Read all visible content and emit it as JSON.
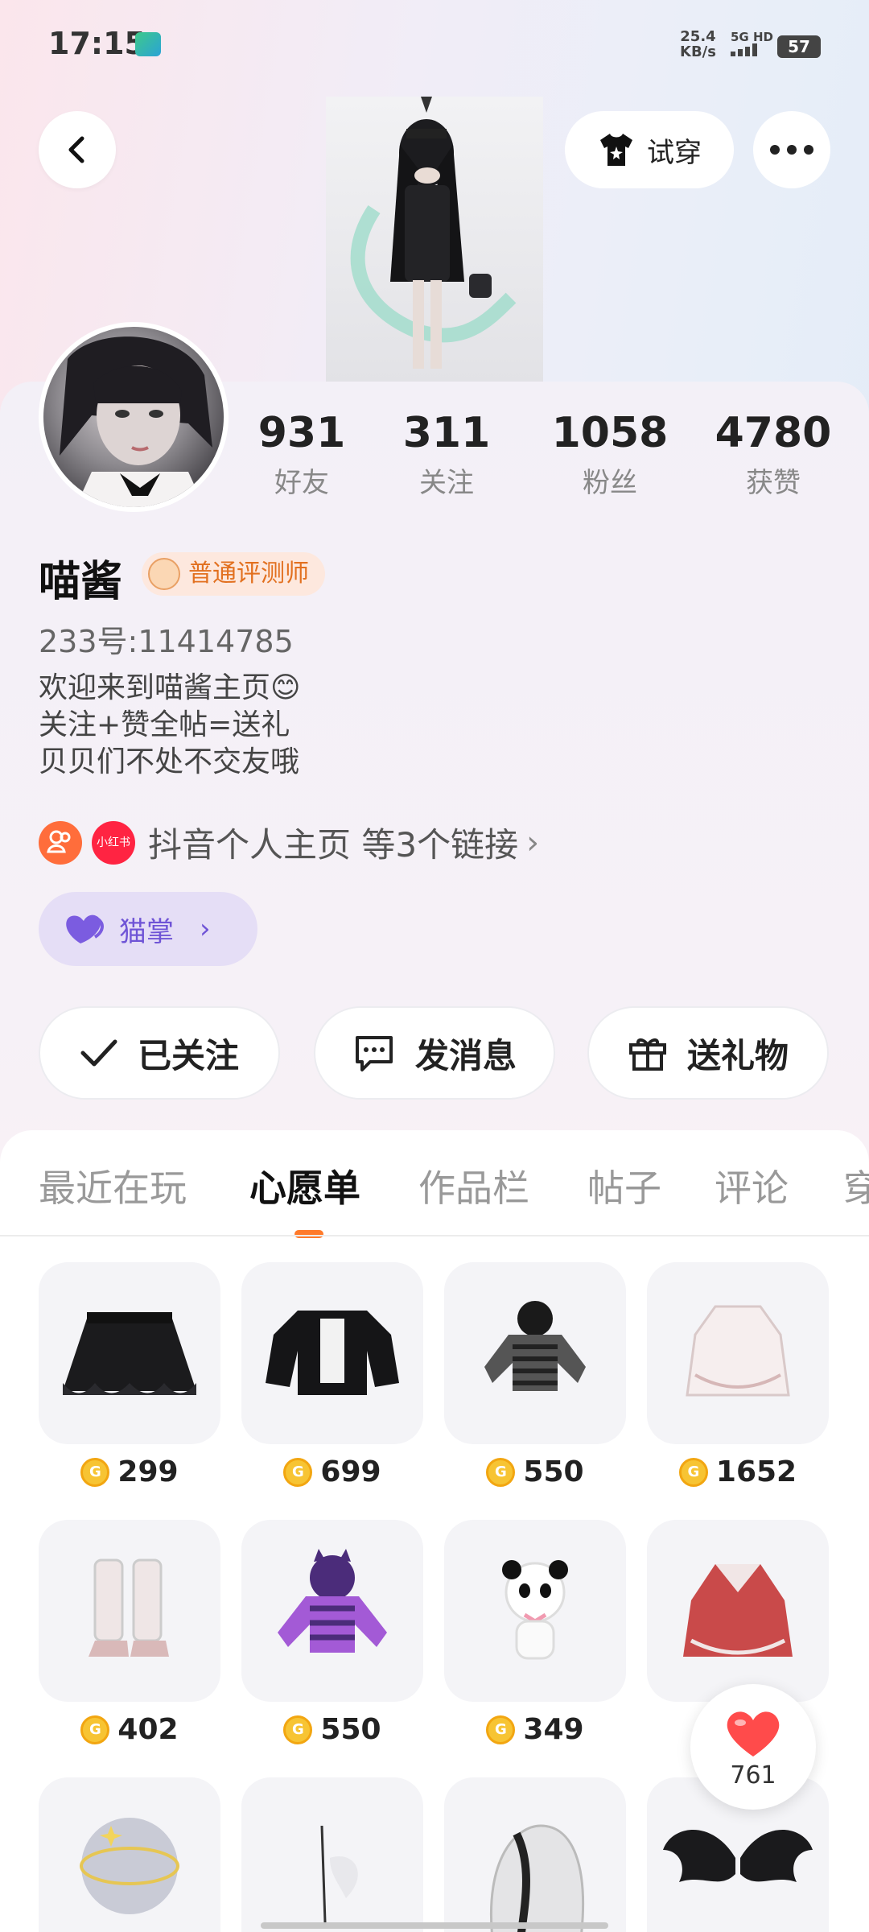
{
  "status_bar": {
    "time": "17:15",
    "net_speed_value": "25.4",
    "net_speed_unit": "KB/s",
    "network": "5G HD",
    "battery": "57"
  },
  "header": {
    "tryon_label": "试穿"
  },
  "profile": {
    "stats": [
      {
        "value": "931",
        "label": "好友"
      },
      {
        "value": "311",
        "label": "关注"
      },
      {
        "value": "1058",
        "label": "粉丝"
      },
      {
        "value": "4780",
        "label": "获赞"
      }
    ],
    "username": "喵酱",
    "badge": "普通评测师",
    "uid": "233号:11414785",
    "bio": [
      "欢迎来到喵酱主页😊",
      "关注+赞全帖=送礼",
      "贝贝们不处不交友哦"
    ],
    "link_icon2_text": "小红书",
    "links_text": "抖音个人主页 等3个链接",
    "paw_label": "猫掌"
  },
  "actions": {
    "followed": "已关注",
    "message": "发消息",
    "gift": "送礼物"
  },
  "tabs": [
    "最近在玩",
    "心愿单",
    "作品栏",
    "帖子",
    "评论",
    "穿"
  ],
  "active_tab": "心愿单",
  "wishlist": [
    {
      "price": "299",
      "icon": "black-skirt"
    },
    {
      "price": "699",
      "icon": "black-jacket"
    },
    {
      "price": "550",
      "icon": "striped-sweater"
    },
    {
      "price": "1652",
      "icon": "white-dress"
    },
    {
      "price": "402",
      "icon": "white-boots"
    },
    {
      "price": "550",
      "icon": "purple-hoodie"
    },
    {
      "price": "349",
      "icon": "panda-plush"
    },
    {
      "price": "",
      "icon": "red-outfit"
    },
    {
      "price": "",
      "icon": "galaxy-halo"
    },
    {
      "price": "",
      "icon": "white-feather"
    },
    {
      "price": "",
      "icon": "white-hair"
    },
    {
      "price": "",
      "icon": "black-wings"
    }
  ],
  "like_fab": {
    "count": "761"
  },
  "colors": {
    "accent": "#ff7a2a",
    "badge_text": "#e2701f",
    "paw": "#6f54d6",
    "coin": "#f7c433"
  }
}
